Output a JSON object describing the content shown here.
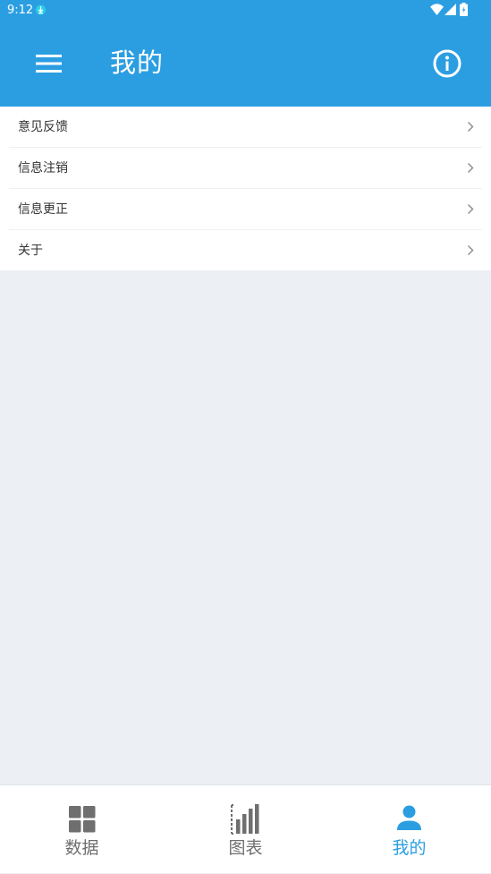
{
  "status_bar": {
    "time": "9:12",
    "icons": [
      "download-icon",
      "wifi-icon",
      "signal-icon",
      "battery-icon"
    ]
  },
  "app_bar": {
    "title": "我的",
    "left_icon": "hamburger-menu-icon",
    "right_icon": "info-icon"
  },
  "menu": {
    "items": [
      {
        "label": "意见反馈"
      },
      {
        "label": "信息注销"
      },
      {
        "label": "信息更正"
      },
      {
        "label": "关于"
      }
    ],
    "item_icon": "chevron-right-icon"
  },
  "bottom_nav": {
    "tabs": [
      {
        "label": "数据",
        "icon": "grid-icon",
        "active": false
      },
      {
        "label": "图表",
        "icon": "bar-chart-icon",
        "active": false
      },
      {
        "label": "我的",
        "icon": "person-icon",
        "active": true
      }
    ]
  },
  "colors": {
    "primary": "#2b9ee2",
    "background": "#ecf0f4",
    "text": "#333333",
    "inactive": "#6f6f6f"
  }
}
